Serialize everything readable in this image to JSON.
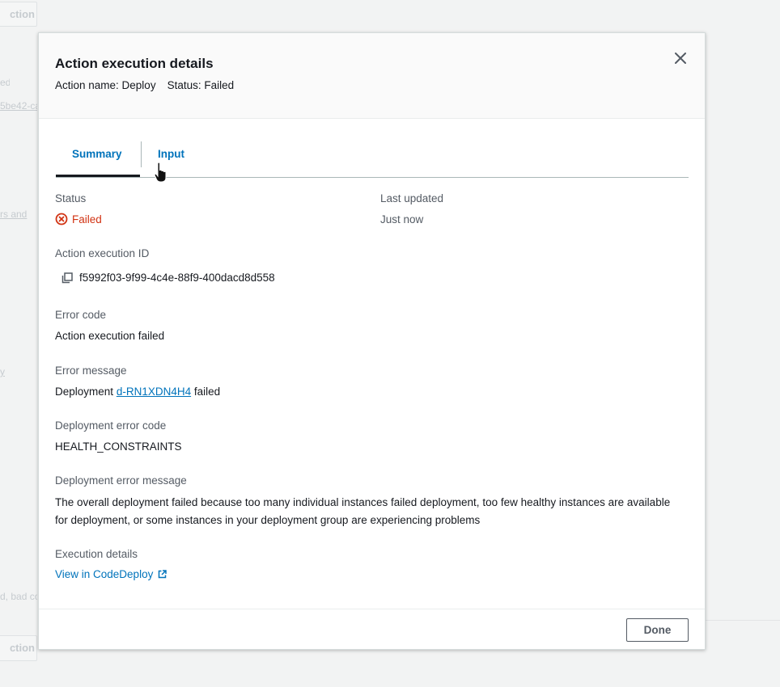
{
  "background": {
    "top_button": "ction",
    "bottom_button": "ction",
    "fragments": [
      "ed",
      "5be42-ca",
      "rs and",
      "y",
      "d, bad co"
    ]
  },
  "modal": {
    "title": "Action execution details",
    "subtitle_action": "Action name: Deploy",
    "subtitle_status": "Status: Failed",
    "close_icon": "close-icon"
  },
  "tabs": [
    {
      "label": "Summary",
      "active": true
    },
    {
      "label": "Input",
      "active": false
    }
  ],
  "summary": {
    "status_label": "Status",
    "status_value": "Failed",
    "status_icon": "error-circle-icon",
    "last_updated_label": "Last updated",
    "last_updated_value": "Just now",
    "execution_id_label": "Action execution ID",
    "execution_id_value": "f5992f03-9f99-4c4e-88f9-400dacd8d558",
    "copy_icon": "copy-icon",
    "error_code_label": "Error code",
    "error_code_value": "Action execution failed",
    "error_message_label": "Error message",
    "error_message_prefix": "Deployment",
    "error_message_link": "d-RN1XDN4H4",
    "error_message_suffix": "failed",
    "deployment_error_code_label": "Deployment error code",
    "deployment_error_code_value": "HEALTH_CONSTRAINTS",
    "deployment_error_message_label": "Deployment error message",
    "deployment_error_message_value": "The overall deployment failed because too many individual instances failed deployment, too few healthy instances are available for deployment, or some instances in your deployment group are experiencing problems",
    "execution_details_label": "Execution details",
    "execution_details_link": "View in CodeDeploy",
    "external_link_icon": "external-link-icon"
  },
  "footer": {
    "done_label": "Done"
  },
  "colors": {
    "link": "#0073bb",
    "error": "#d13212",
    "text": "#16191f",
    "muted": "#545b64"
  }
}
